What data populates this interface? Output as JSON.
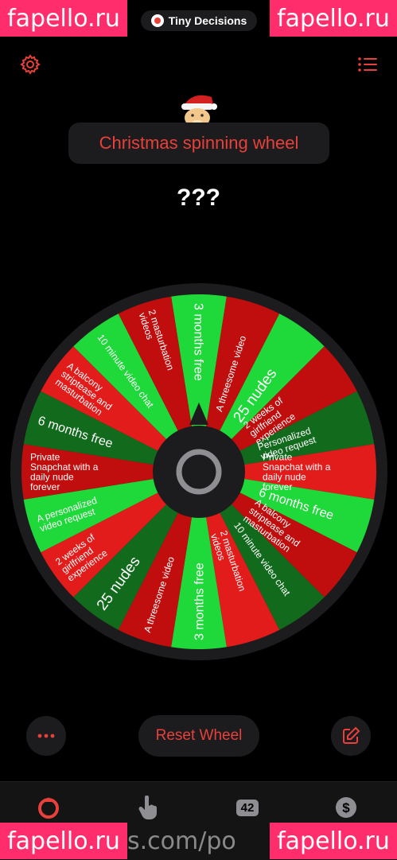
{
  "app": {
    "name": "Tiny Decisions"
  },
  "watermarks": {
    "top_left": "fapello.ru",
    "top_right": "fapello.ru",
    "bottom_left": "fapello.ru",
    "bottom_middle": "s.com/po",
    "bottom_right": "fapello.ru"
  },
  "header": {
    "title": "Christmas spinning wheel",
    "result": "???"
  },
  "wheel": {
    "segments": [
      {
        "label": "3 months free",
        "color": "#1fd83a"
      },
      {
        "label": "A threesome video",
        "color": "#c00d0d"
      },
      {
        "label": "25 nudes",
        "color": "#1fd83a"
      },
      {
        "label": "2 weeks of girlfriend experience",
        "color": "#c00d0d"
      },
      {
        "label": "Personalized video request",
        "color": "#126a1c"
      },
      {
        "label": "Private Snapchat with a daily nude forever",
        "color": "#e21b1b"
      },
      {
        "label": "6 months free",
        "color": "#1fd83a"
      },
      {
        "label": "A balcony striptease and masturbation",
        "color": "#c00d0d"
      },
      {
        "label": "10 minute video chat",
        "color": "#126a1c"
      },
      {
        "label": "2 masturbation videos",
        "color": "#e21b1b"
      },
      {
        "label": "3 months free",
        "color": "#1fd83a"
      },
      {
        "label": "A threesome video",
        "color": "#c00d0d"
      },
      {
        "label": "25 nudes",
        "color": "#126a1c"
      },
      {
        "label": "2 weeks of girlfriend experience",
        "color": "#e21b1b"
      },
      {
        "label": "A personalized video request",
        "color": "#1fd83a"
      },
      {
        "label": "Private Snapchat with a daily nude forever",
        "color": "#c00d0d"
      },
      {
        "label": "6 months free",
        "color": "#126a1c"
      },
      {
        "label": "A balcony striptease and masturbation",
        "color": "#e21b1b"
      },
      {
        "label": "10 minute video chat",
        "color": "#1fd83a"
      },
      {
        "label": "2 masturbation videos",
        "color": "#c00d0d"
      }
    ]
  },
  "actions": {
    "reset_label": "Reset Wheel"
  },
  "tabs": {
    "count_badge": "42"
  },
  "colors": {
    "accent": "#e8403a",
    "panel": "#1c1c1e"
  }
}
